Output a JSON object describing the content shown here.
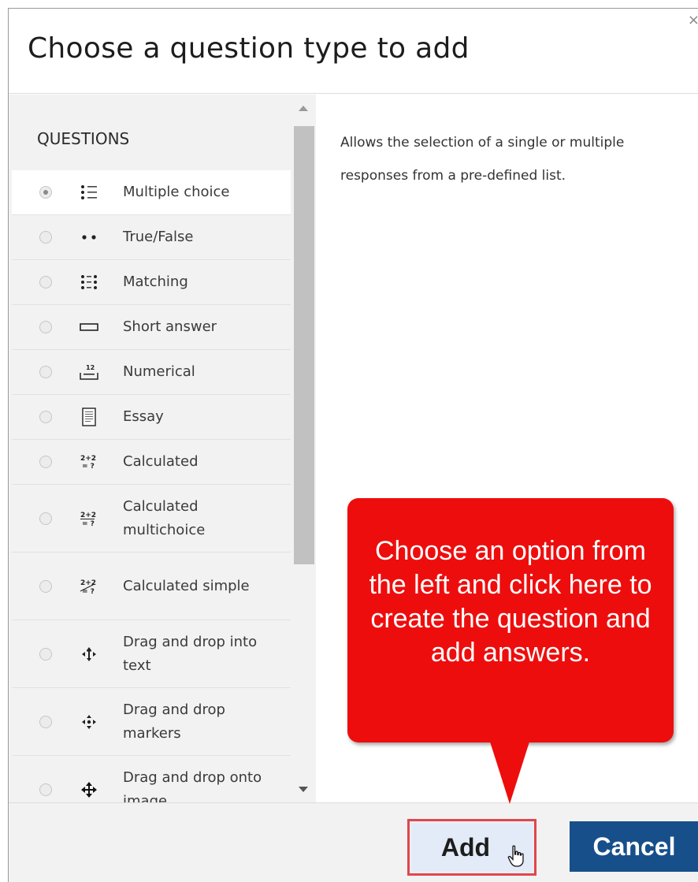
{
  "dialog": {
    "title": "Choose a question type to add",
    "close_glyph": "×"
  },
  "left": {
    "section_label": "QUESTIONS",
    "items": [
      {
        "label": "Multiple choice",
        "icon": "multiple-choice-icon",
        "selected": true
      },
      {
        "label": "True/False",
        "icon": "true-false-icon"
      },
      {
        "label": "Matching",
        "icon": "matching-icon"
      },
      {
        "label": "Short answer",
        "icon": "short-answer-icon"
      },
      {
        "label": "Numerical",
        "icon": "numerical-icon"
      },
      {
        "label": "Essay",
        "icon": "essay-icon"
      },
      {
        "label": "Calculated",
        "icon": "calculated-icon"
      },
      {
        "label": "Calculated multichoice",
        "icon": "calculated-multichoice-icon"
      },
      {
        "label": "Calculated simple",
        "icon": "calculated-simple-icon"
      },
      {
        "label": "Drag and drop into text",
        "icon": "drag-drop-text-icon"
      },
      {
        "label": "Drag and drop markers",
        "icon": "drag-drop-markers-icon"
      },
      {
        "label": "Drag and drop onto image",
        "icon": "drag-drop-image-icon"
      }
    ],
    "icon_text": {
      "numerical": "12",
      "calculated": "2+2\n= ?"
    }
  },
  "right": {
    "description": "Allows the selection of a single or multiple responses from a pre-defined list."
  },
  "footer": {
    "add_label": "Add",
    "cancel_label": "Cancel"
  },
  "callout": {
    "text": "Choose an option from the left and click here to create the question and add answers."
  },
  "colors": {
    "callout": "#ee0d0d",
    "cancel_bg": "#174f8a",
    "add_border": "#e0474c",
    "pane_bg": "#f2f2f2"
  }
}
